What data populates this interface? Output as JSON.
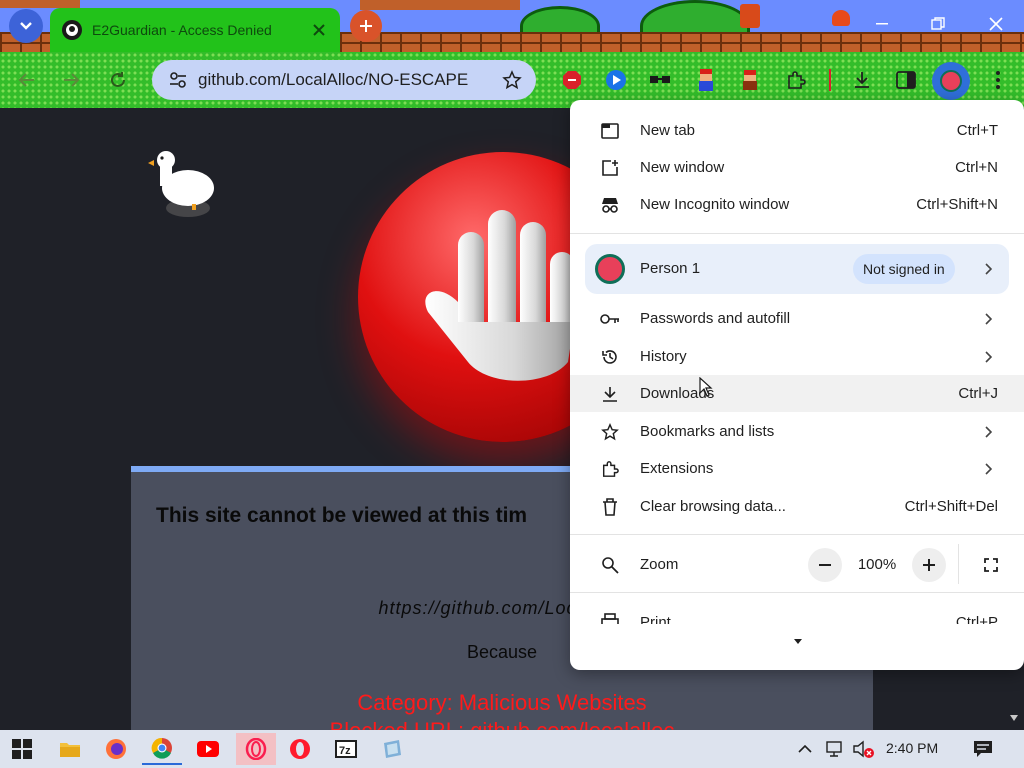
{
  "tab": {
    "title": "E2Guardian - Access Denied"
  },
  "omnibox": {
    "url": "github.com/LocalAlloc/NO-ESCAPE"
  },
  "page": {
    "heading": "This site cannot be viewed at this tim",
    "url": "https://github.com/LocalAllc",
    "because": "Because",
    "category": "Category: Malicious Websites",
    "blocked": "Blocked URL: github.com/localalloc"
  },
  "menu": {
    "items": [
      {
        "label": "New tab",
        "shortcut": "Ctrl+T"
      },
      {
        "label": "New window",
        "shortcut": "Ctrl+N"
      },
      {
        "label": "New Incognito window",
        "shortcut": "Ctrl+Shift+N"
      }
    ],
    "person": {
      "name": "Person 1",
      "status": "Not signed in"
    },
    "items2": [
      {
        "label": "Passwords and autofill",
        "shortcut": ""
      },
      {
        "label": "History",
        "shortcut": ""
      },
      {
        "label": "Downloads",
        "shortcut": "Ctrl+J"
      },
      {
        "label": "Bookmarks and lists",
        "shortcut": ""
      },
      {
        "label": "Extensions",
        "shortcut": ""
      },
      {
        "label": "Clear browsing data...",
        "shortcut": "Ctrl+Shift+Del"
      }
    ],
    "zoom": {
      "label": "Zoom",
      "value": "100%"
    },
    "print": {
      "label": "Print",
      "shortcut": "Ctrl+P"
    }
  },
  "taskbar": {
    "time": "2:40 PM"
  },
  "colors": {
    "tab_active": "#22c21a",
    "toolbar": "#33bd2a",
    "stop_red": "#e01010",
    "category_red": "#ff1a1a",
    "content_box": "#4a4f5e",
    "menu_hover": "#f1f1f1",
    "person_bg": "#e8effa"
  }
}
